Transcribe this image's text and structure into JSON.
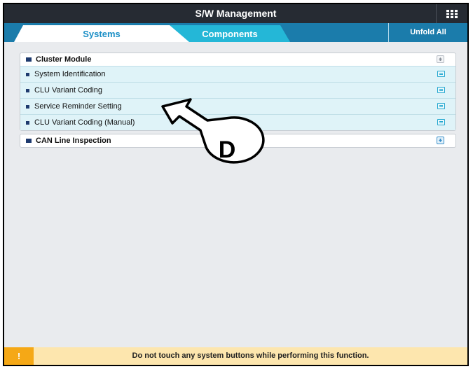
{
  "window": {
    "title": "S/W Management"
  },
  "tabs": [
    {
      "label": "Systems",
      "active": true
    },
    {
      "label": "Components",
      "active": false
    }
  ],
  "toolbar": {
    "unfold_all_label": "Unfold All"
  },
  "groups": [
    {
      "title": "Cluster Module",
      "expanded": true,
      "items": [
        {
          "label": "System Identification"
        },
        {
          "label": "CLU Variant Coding"
        },
        {
          "label": "Service Reminder Setting"
        },
        {
          "label": "CLU Variant Coding (Manual)"
        }
      ]
    },
    {
      "title": "CAN Line Inspection",
      "expanded": false,
      "items": []
    }
  ],
  "footer": {
    "warning_icon": "!",
    "message": "Do not touch any system buttons while performing this function."
  },
  "annotation": {
    "label": "D"
  },
  "colors": {
    "title_bar": "#262b33",
    "tab_bar": "#1b7cab",
    "tab_inactive": "#24b7d7",
    "item_background": "#dff3f8",
    "warning": "#f5a816",
    "footer_background": "#fde6ae"
  }
}
